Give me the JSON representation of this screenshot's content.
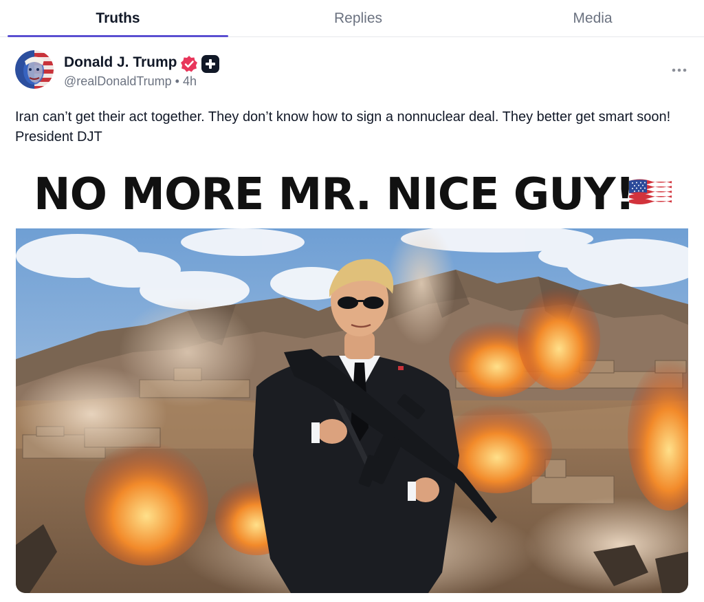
{
  "tabs": [
    {
      "label": "Truths",
      "active": true
    },
    {
      "label": "Replies",
      "active": false
    },
    {
      "label": "Media",
      "active": false
    }
  ],
  "post": {
    "author": {
      "name": "Donald J. Trump",
      "handle_time": "@realDonaldTrump • 4h"
    },
    "text": "Iran can’t get their act together. They don’t know how to sign a nonnuclear deal. They better get smart soon! President DJT",
    "media": {
      "headline": "NO MORE MR. NICE GUY!"
    }
  },
  "icons": {
    "verified": "verified-badge-icon",
    "plus": "plus-badge-icon",
    "more": "more-options-icon",
    "flag": "us-flag-icon"
  },
  "colors": {
    "accent": "#5a4fd1",
    "verified": "#e8365b"
  }
}
